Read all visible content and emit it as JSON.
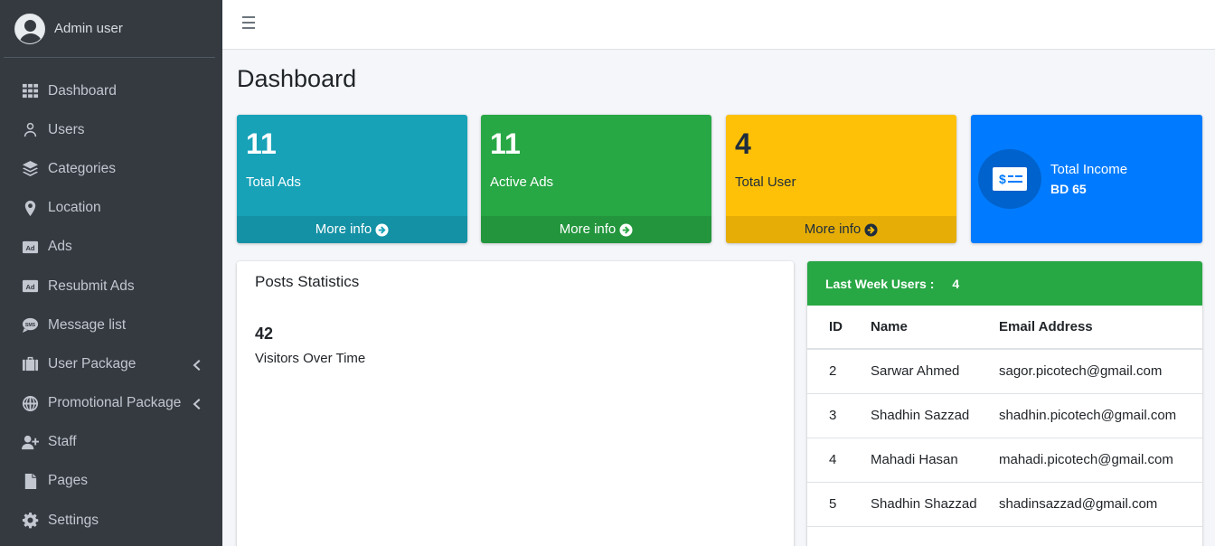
{
  "sidebar": {
    "user_name": "Admin user",
    "items": [
      {
        "label": "Dashboard",
        "icon": "grid-icon"
      },
      {
        "label": "Users",
        "icon": "user-icon"
      },
      {
        "label": "Categories",
        "icon": "layers-icon"
      },
      {
        "label": "Location",
        "icon": "map-marker-icon"
      },
      {
        "label": "Ads",
        "icon": "ad-icon"
      },
      {
        "label": "Resubmit Ads",
        "icon": "ad-icon"
      },
      {
        "label": "Message list",
        "icon": "sms-icon"
      },
      {
        "label": "User Package",
        "icon": "suitcase-icon",
        "has_submenu": true
      },
      {
        "label": "Promotional Package",
        "icon": "globe-icon",
        "has_submenu": true
      },
      {
        "label": "Staff",
        "icon": "user-plus-icon"
      },
      {
        "label": "Pages",
        "icon": "file-icon"
      },
      {
        "label": "Settings",
        "icon": "gear-icon"
      }
    ]
  },
  "main": {
    "title": "Dashboard",
    "boxes": [
      {
        "value": "11",
        "label": "Total Ads",
        "more": "More info",
        "color": "#17a2b8"
      },
      {
        "value": "11",
        "label": "Active Ads",
        "more": "More info",
        "color": "#28a745"
      },
      {
        "value": "4",
        "label": "Total User",
        "more": "More info",
        "color": "#ffc107"
      }
    ],
    "income": {
      "label": "Total Income",
      "amount": "BD 65",
      "color": "#007bff"
    },
    "posts": {
      "title": "Posts Statistics",
      "value": "42",
      "label": "Visitors Over Time"
    },
    "last_week": {
      "title": "Last Week Users :",
      "count": "4",
      "columns": [
        "ID",
        "Name",
        "Email Address"
      ],
      "rows": [
        [
          "2",
          "Sarwar Ahmed",
          "sagor.picotech@gmail.com"
        ],
        [
          "3",
          "Shadhin Sazzad",
          "shadhin.picotech@gmail.com"
        ],
        [
          "4",
          "Mahadi Hasan",
          "mahadi.picotech@gmail.com"
        ],
        [
          "5",
          "Shadhin Shazzad",
          "shadinsazzad@gmail.com"
        ]
      ]
    }
  }
}
